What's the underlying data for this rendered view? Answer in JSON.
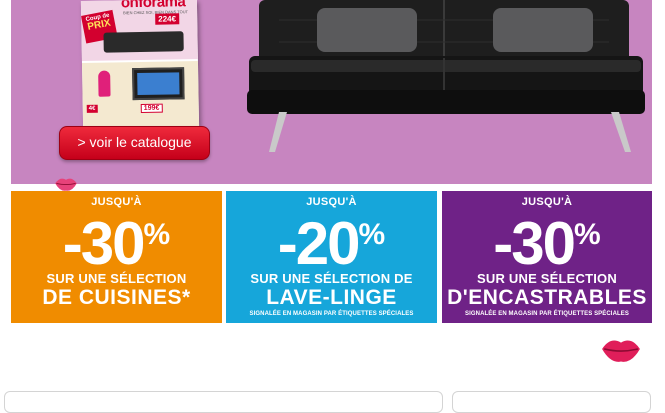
{
  "hero": {
    "catalog_brand": "onforama",
    "catalog_tagline": "BIEN CHEZ SOI, BIEN DANS TOUT",
    "catalog_badge_line1": "Coup de",
    "catalog_badge_line2": "PRIX",
    "catalog_price_top": "224€",
    "catalog_price_tv": "199€",
    "catalog_price_lamp": "4€",
    "button_label": "> voir le catalogue"
  },
  "promos": [
    {
      "header": "JUSQU'À",
      "value": "-30",
      "unit": "%",
      "line1": "SUR UNE SÉLECTION",
      "line2": "DE CUISINES*",
      "line3": "",
      "color": "#f08c00"
    },
    {
      "header": "JUSQU'À",
      "value": "-20",
      "unit": "%",
      "line1": "SUR UNE SÉLECTION DE",
      "line2": "LAVE-LINGE",
      "line3": "SIGNALÉE EN MAGASIN PAR ÉTIQUETTES SPÉCIALES",
      "color": "#16a6da"
    },
    {
      "header": "JUSQU'À",
      "value": "-30",
      "unit": "%",
      "line1": "SUR UNE SÉLECTION",
      "line2": "D'ENCASTRABLES",
      "line3": "SIGNALÉE EN MAGASIN PAR ÉTIQUETTES SPÉCIALES",
      "color": "#6f2287"
    }
  ],
  "colors": {
    "hero_background": "#c785c0",
    "button_red": "#d3002f",
    "lips": "#e01e5a"
  },
  "icons": [
    "lips-kiss-icon",
    "lips-kiss-icon",
    "lips-kiss-icon"
  ]
}
